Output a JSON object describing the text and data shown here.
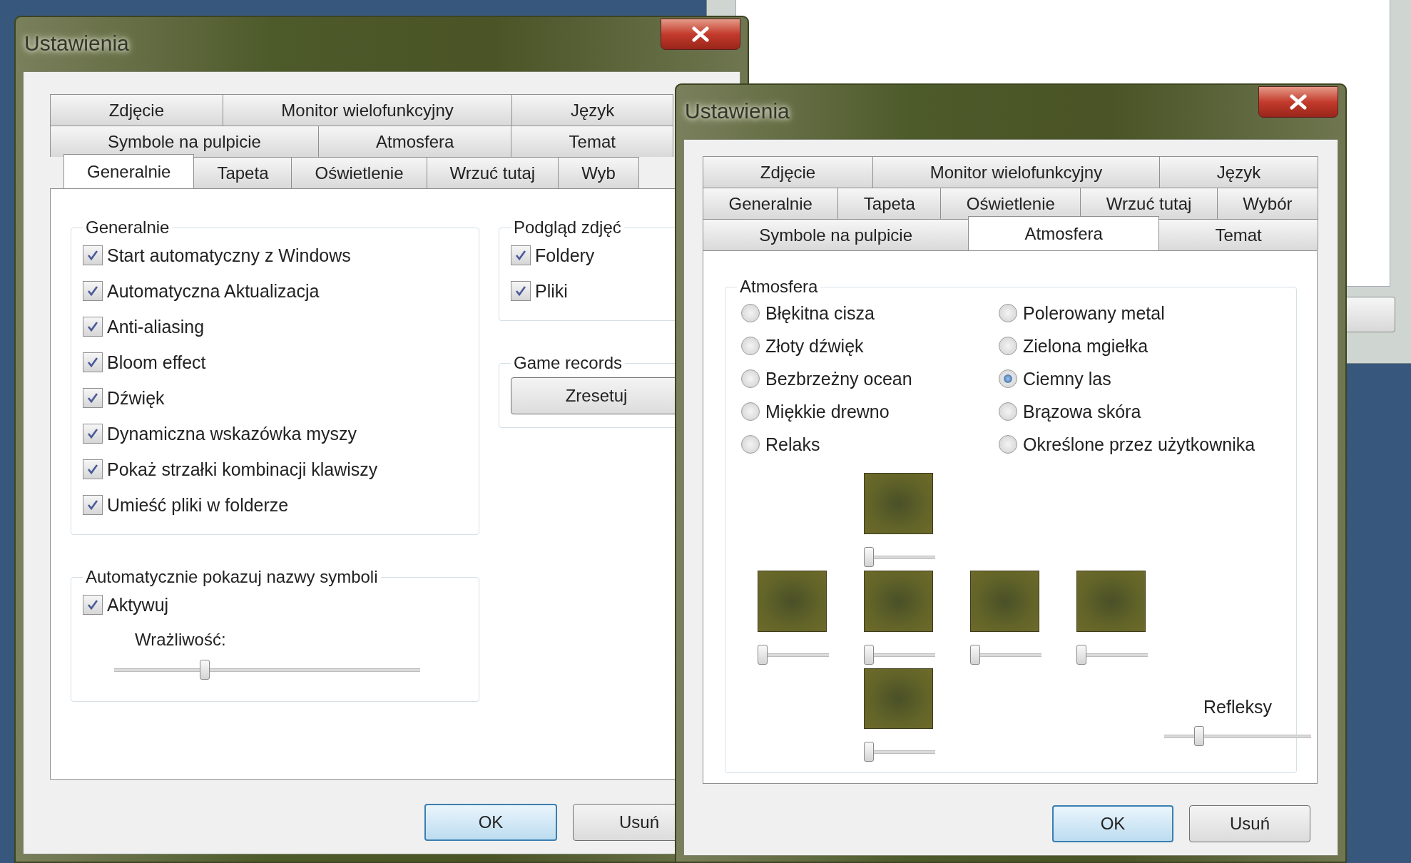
{
  "back_dialog": {
    "title": "Ustawienia",
    "tab_rows": [
      {
        "tabs": [
          {
            "label": "Zdjęcie",
            "selected": false
          },
          {
            "label": "Monitor wielofunkcyjny",
            "selected": false
          },
          {
            "label": "Język",
            "selected": false
          }
        ]
      },
      {
        "tabs": [
          {
            "label": "Symbole na pulpicie",
            "selected": false
          },
          {
            "label": "Atmosfera",
            "selected": false
          },
          {
            "label": "Temat",
            "selected": false
          }
        ]
      },
      {
        "tabs": [
          {
            "label": "Generalnie",
            "selected": true
          },
          {
            "label": "Tapeta",
            "selected": false
          },
          {
            "label": "Oświetlenie",
            "selected": false
          },
          {
            "label": "Wrzuć tutaj",
            "selected": false
          },
          {
            "label": "Wyb",
            "selected": false
          }
        ]
      }
    ],
    "general_group": {
      "title": "Generalnie",
      "options": [
        {
          "label": "Start automatyczny z Windows",
          "checked": true
        },
        {
          "label": "Automatyczna Aktualizacja",
          "checked": true
        },
        {
          "label": "Anti-aliasing",
          "checked": true
        },
        {
          "label": "Bloom effect",
          "checked": true
        },
        {
          "label": "Dźwięk",
          "checked": true
        },
        {
          "label": "Dynamiczna wskazówka myszy",
          "checked": true
        },
        {
          "label": "Pokaż strzałki kombinacji klawiszy",
          "checked": true
        },
        {
          "label": "Umieść pliki w folderze",
          "checked": true
        }
      ]
    },
    "symbol_names_group": {
      "title": "Automatycznie pokazuj nazwy symboli",
      "activate": {
        "label": "Aktywuj",
        "checked": true
      },
      "sensitivity": {
        "label": "Wrażliwość:",
        "level": 0.29
      }
    },
    "photo_preview_group": {
      "title": "Podgląd zdjęć",
      "options": [
        {
          "label": "Foldery",
          "checked": true
        },
        {
          "label": "Pliki",
          "checked": true
        }
      ]
    },
    "game_records_group": {
      "title": "Game records",
      "button": "Zresetuj"
    },
    "buttons": [
      {
        "label": "OK",
        "default": true
      },
      {
        "label": "Usuń",
        "default": false
      }
    ]
  },
  "front_dialog": {
    "title": "Ustawienia",
    "tab_rows": [
      {
        "tabs": [
          {
            "label": "Zdjęcie",
            "selected": false
          },
          {
            "label": "Monitor wielofunkcyjny",
            "selected": false
          },
          {
            "label": "Język",
            "selected": false
          }
        ]
      },
      {
        "tabs": [
          {
            "label": "Generalnie",
            "selected": false
          },
          {
            "label": "Tapeta",
            "selected": false
          },
          {
            "label": "Oświetlenie",
            "selected": false
          },
          {
            "label": "Wrzuć tutaj",
            "selected": false
          },
          {
            "label": "Wybór",
            "selected": false
          }
        ]
      },
      {
        "tabs": [
          {
            "label": "Symbole na pulpicie",
            "selected": false
          },
          {
            "label": "Atmosfera",
            "selected": true
          },
          {
            "label": "Temat",
            "selected": false
          }
        ]
      }
    ],
    "atmosphere_group": {
      "title": "Atmosfera",
      "themes": [
        {
          "label": "Błękitna cisza",
          "selected": false
        },
        {
          "label": "Polerowany metal",
          "selected": false
        },
        {
          "label": "Złoty dźwięk",
          "selected": false
        },
        {
          "label": "Zielona mgiełka",
          "selected": false
        },
        {
          "label": "Bezbrzeżny ocean",
          "selected": false
        },
        {
          "label": "Ciemny las",
          "selected": true
        },
        {
          "label": "Miękkie drewno",
          "selected": false
        },
        {
          "label": "Brązowa skóra",
          "selected": false
        },
        {
          "label": "Relaks",
          "selected": false
        },
        {
          "label": "Określone przez użytkownika",
          "selected": false
        }
      ],
      "swatches": [
        {
          "level": 0
        },
        {
          "level": 0
        },
        {
          "level": 0
        },
        {
          "level": 0
        },
        {
          "level": 0
        },
        {
          "level": 0
        }
      ],
      "reflections": {
        "label": "Refleksy",
        "level": 0.22
      }
    },
    "buttons": [
      {
        "label": "OK",
        "default": true
      },
      {
        "label": "Usuń",
        "default": false
      }
    ]
  }
}
